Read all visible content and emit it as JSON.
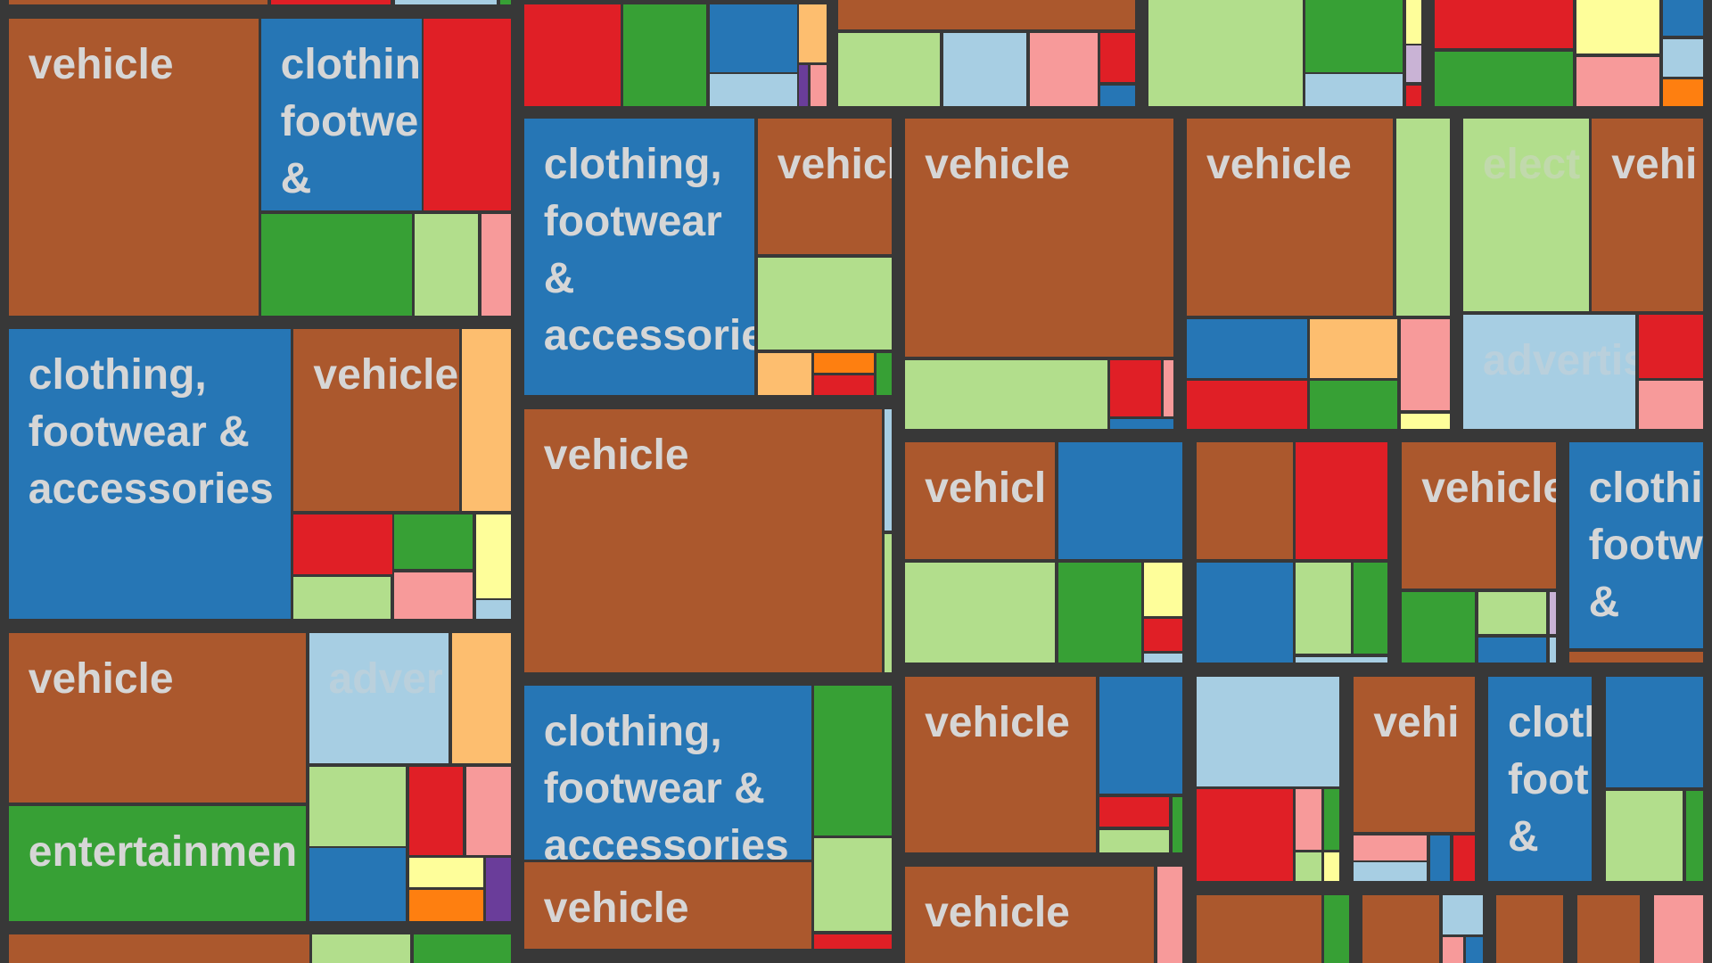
{
  "chart_data": {
    "type": "treemap",
    "title": "",
    "palette": {
      "vehicle": "#ab582d",
      "clothing, footwear & accessories": "#2676b5",
      "entertainment": "#37a035",
      "advertising": "#a7cee3",
      "electronics": "#b2de8c",
      "red": "#e01f26",
      "pink": "#f79a9a",
      "yellow": "#fefe9a",
      "orange": "#fdbe6f",
      "dark-orange": "#fe7f10",
      "purple": "#6a3d9a",
      "lavender": "#c9b3d5"
    },
    "visible_labels": [
      "vehicle",
      "clothin\nfootwe\n&",
      "clothing,\nfootwear &\naccessories",
      "clothing,\nfootwear\n&\naccessorie",
      "vehicl",
      "vehicle",
      "adver",
      "entertainmen",
      "elect",
      "vehi",
      "advertis",
      "clothi\nfootw\n&",
      "cloth\nfoot\n&"
    ]
  }
}
